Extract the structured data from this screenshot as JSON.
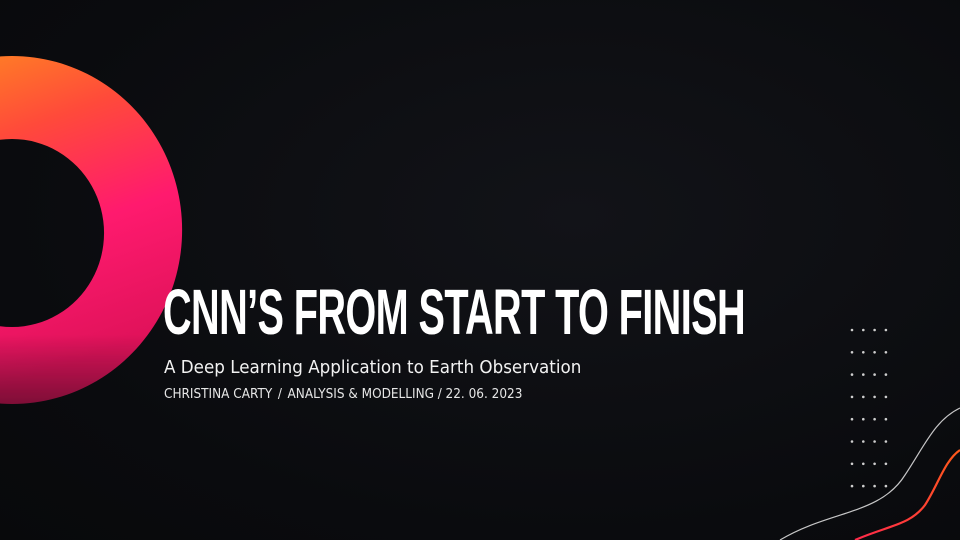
{
  "slide": {
    "title": "CNN’S FROM START TO FINISH",
    "subtitle": "A Deep Learning Application to Earth Observation",
    "byline": {
      "author": "CHRISTINA CARTY",
      "separator_1": "/",
      "department": "ANALYSIS & MODELLING",
      "separator_2": "/",
      "date": "22. 06. 2023"
    }
  },
  "decor": {
    "ring_icon": "gradient-ring-icon",
    "dots_icon": "dot-grid-icon",
    "waves_icon": "wave-lines-icon"
  },
  "colors": {
    "background": "#0b0c10",
    "ring_orange": "#ff8a1f",
    "ring_pink": "#ff1f73",
    "ring_magenta": "#d8145a",
    "wave_red": "#ff3a2a",
    "wave_white": "#dddddd",
    "text": "#ffffff"
  }
}
